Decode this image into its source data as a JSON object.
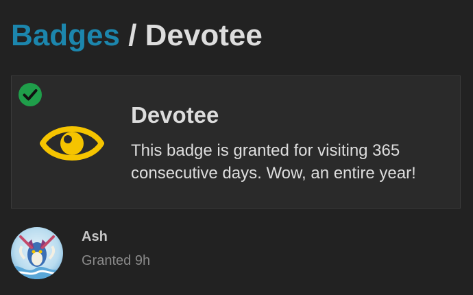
{
  "breadcrumb": {
    "parent": "Badges",
    "separator": "/",
    "current": "Devotee"
  },
  "badge": {
    "name": "Devotee",
    "description": "This badge is granted for visiting 365 consecutive days. Wow, an entire year!",
    "icon": "eye-icon",
    "granted_indicator_icon": "check-circle-icon"
  },
  "grant": {
    "user": "Ash",
    "granted_text": "Granted 9h",
    "avatar": "user-avatar"
  },
  "colors": {
    "link": "#1c86ad",
    "eye": "#f5c400",
    "check": "#1f9e4a",
    "background": "#222222"
  }
}
